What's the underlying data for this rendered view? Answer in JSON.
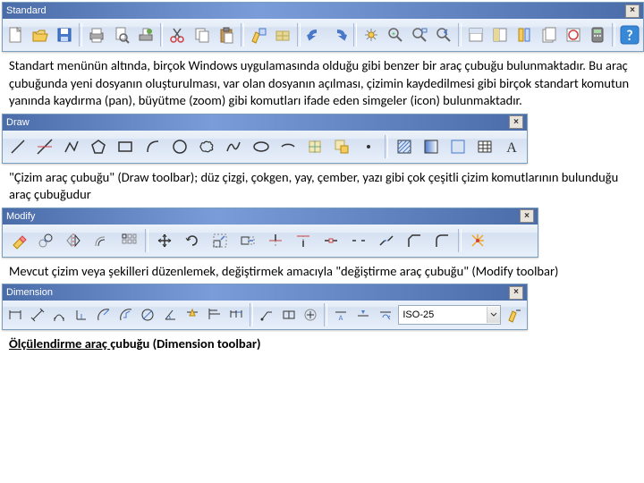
{
  "toolbars": {
    "standard": {
      "title": "Standard"
    },
    "draw": {
      "title": "Draw"
    },
    "modify": {
      "title": "Modify"
    },
    "dimension": {
      "title": "Dimension",
      "style_value": "ISO-25"
    }
  },
  "paragraphs": {
    "p1": "Standart menünün altında, birçok Windows uygulamasında olduğu gibi benzer bir araç çubuğu bulunmaktadır. Bu araç çubuğunda yeni dosyanın oluşturulması, var olan dosyanın açılması, çizimin kaydedilmesi gibi birçok standart komutun yanında kaydırma (pan), büyütme (zoom) gibi komutları ifade eden simgeler (icon) bulunmaktadır.",
    "p2": "\"Çizim araç çubuğu\" (Draw toolbar); düz çizgi, çokgen, yay, çember, yazı gibi çok çeşitli çizim komutlarının bulunduğu araç çubuğudur",
    "p3": "Mevcut çizim veya şekilleri düzenlemek, değiştirmek amacıyla \"değiştirme araç çubuğu\" (Modify toolbar)",
    "p4_a": "Ölçülendirme araç ",
    "p4_b": "çubuğu (Dimension toolbar)"
  }
}
